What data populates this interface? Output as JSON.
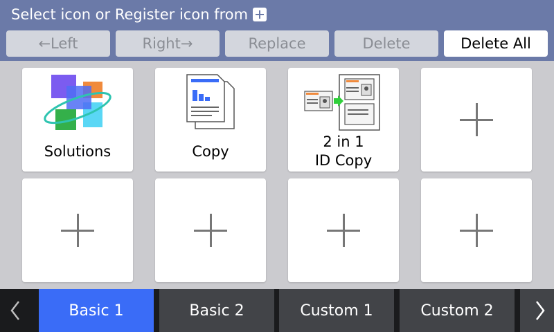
{
  "header": {
    "title": "Select icon or Register icon from",
    "plus_icon": "plus-box-icon"
  },
  "toolbar": {
    "left_label": "←Left",
    "right_label": "Right→",
    "replace_label": "Replace",
    "delete_label": "Delete",
    "delete_all_label": "Delete All"
  },
  "tiles": [
    {
      "label": "Solutions",
      "icon": "solutions-icon"
    },
    {
      "label": "Copy",
      "icon": "copy-icon"
    },
    {
      "label_line1": "2 in 1",
      "label_line2": "ID Copy",
      "icon": "id-copy-icon"
    },
    {
      "icon": "plus-icon"
    },
    {
      "icon": "plus-icon"
    },
    {
      "icon": "plus-icon"
    },
    {
      "icon": "plus-icon"
    },
    {
      "icon": "plus-icon"
    }
  ],
  "tabs": [
    {
      "label": "Basic 1",
      "selected": true
    },
    {
      "label": "Basic 2",
      "selected": false
    },
    {
      "label": "Custom 1",
      "selected": false
    },
    {
      "label": "Custom 2",
      "selected": false
    }
  ],
  "colors": {
    "header_bg": "#6b7aa8",
    "selected_tab": "#3a6cf7",
    "tab_bg": "#424448",
    "tab_bar_bg": "#1a1b1d"
  }
}
